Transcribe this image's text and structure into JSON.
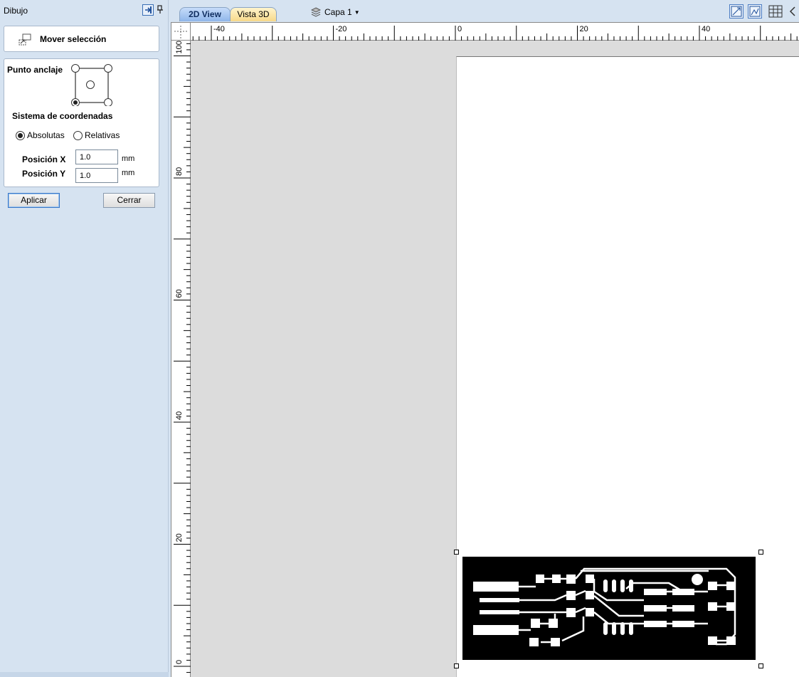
{
  "panel": {
    "title": "Dibujo",
    "header_icons": [
      "dock-icon",
      "pin-icon"
    ]
  },
  "tool": {
    "title": "Mover selección",
    "icon": "move-selection-icon"
  },
  "anchor": {
    "label": "Punto anclaje",
    "selected": "bottom-left"
  },
  "coords": {
    "label": "Sistema de coordenadas",
    "absolute_label": "Absolutas",
    "relative_label": "Relativas",
    "selected": "absolute"
  },
  "position": {
    "x_label": "Posición X",
    "x_value": "1.0",
    "y_label": "Posición Y",
    "y_value": "1.0",
    "unit": "mm"
  },
  "buttons": {
    "apply": "Aplicar",
    "close": "Cerrar"
  },
  "tabs": [
    {
      "label": "2D View",
      "active": true
    },
    {
      "label": "Vista 3D",
      "active": false
    }
  ],
  "layer": {
    "label": "Capa 1",
    "icon": "layer-icon"
  },
  "toolbar_icons": [
    "zoom-extents-icon",
    "zoom-selection-icon",
    "grid-icon",
    "more-icon"
  ],
  "rulers": {
    "horizontal_labels": [
      "-40",
      "-20",
      "0",
      "20",
      "40"
    ],
    "vertical_labels": [
      "100",
      "80",
      "60",
      "40",
      "20",
      "0"
    ]
  },
  "colors": {
    "panel_bg": "#d6e3f1",
    "tab_2d": "#8fb6ea",
    "tab_3d": "#f7d98a",
    "canvas_bg": "#dcdcdc",
    "pcb": "#000000"
  }
}
